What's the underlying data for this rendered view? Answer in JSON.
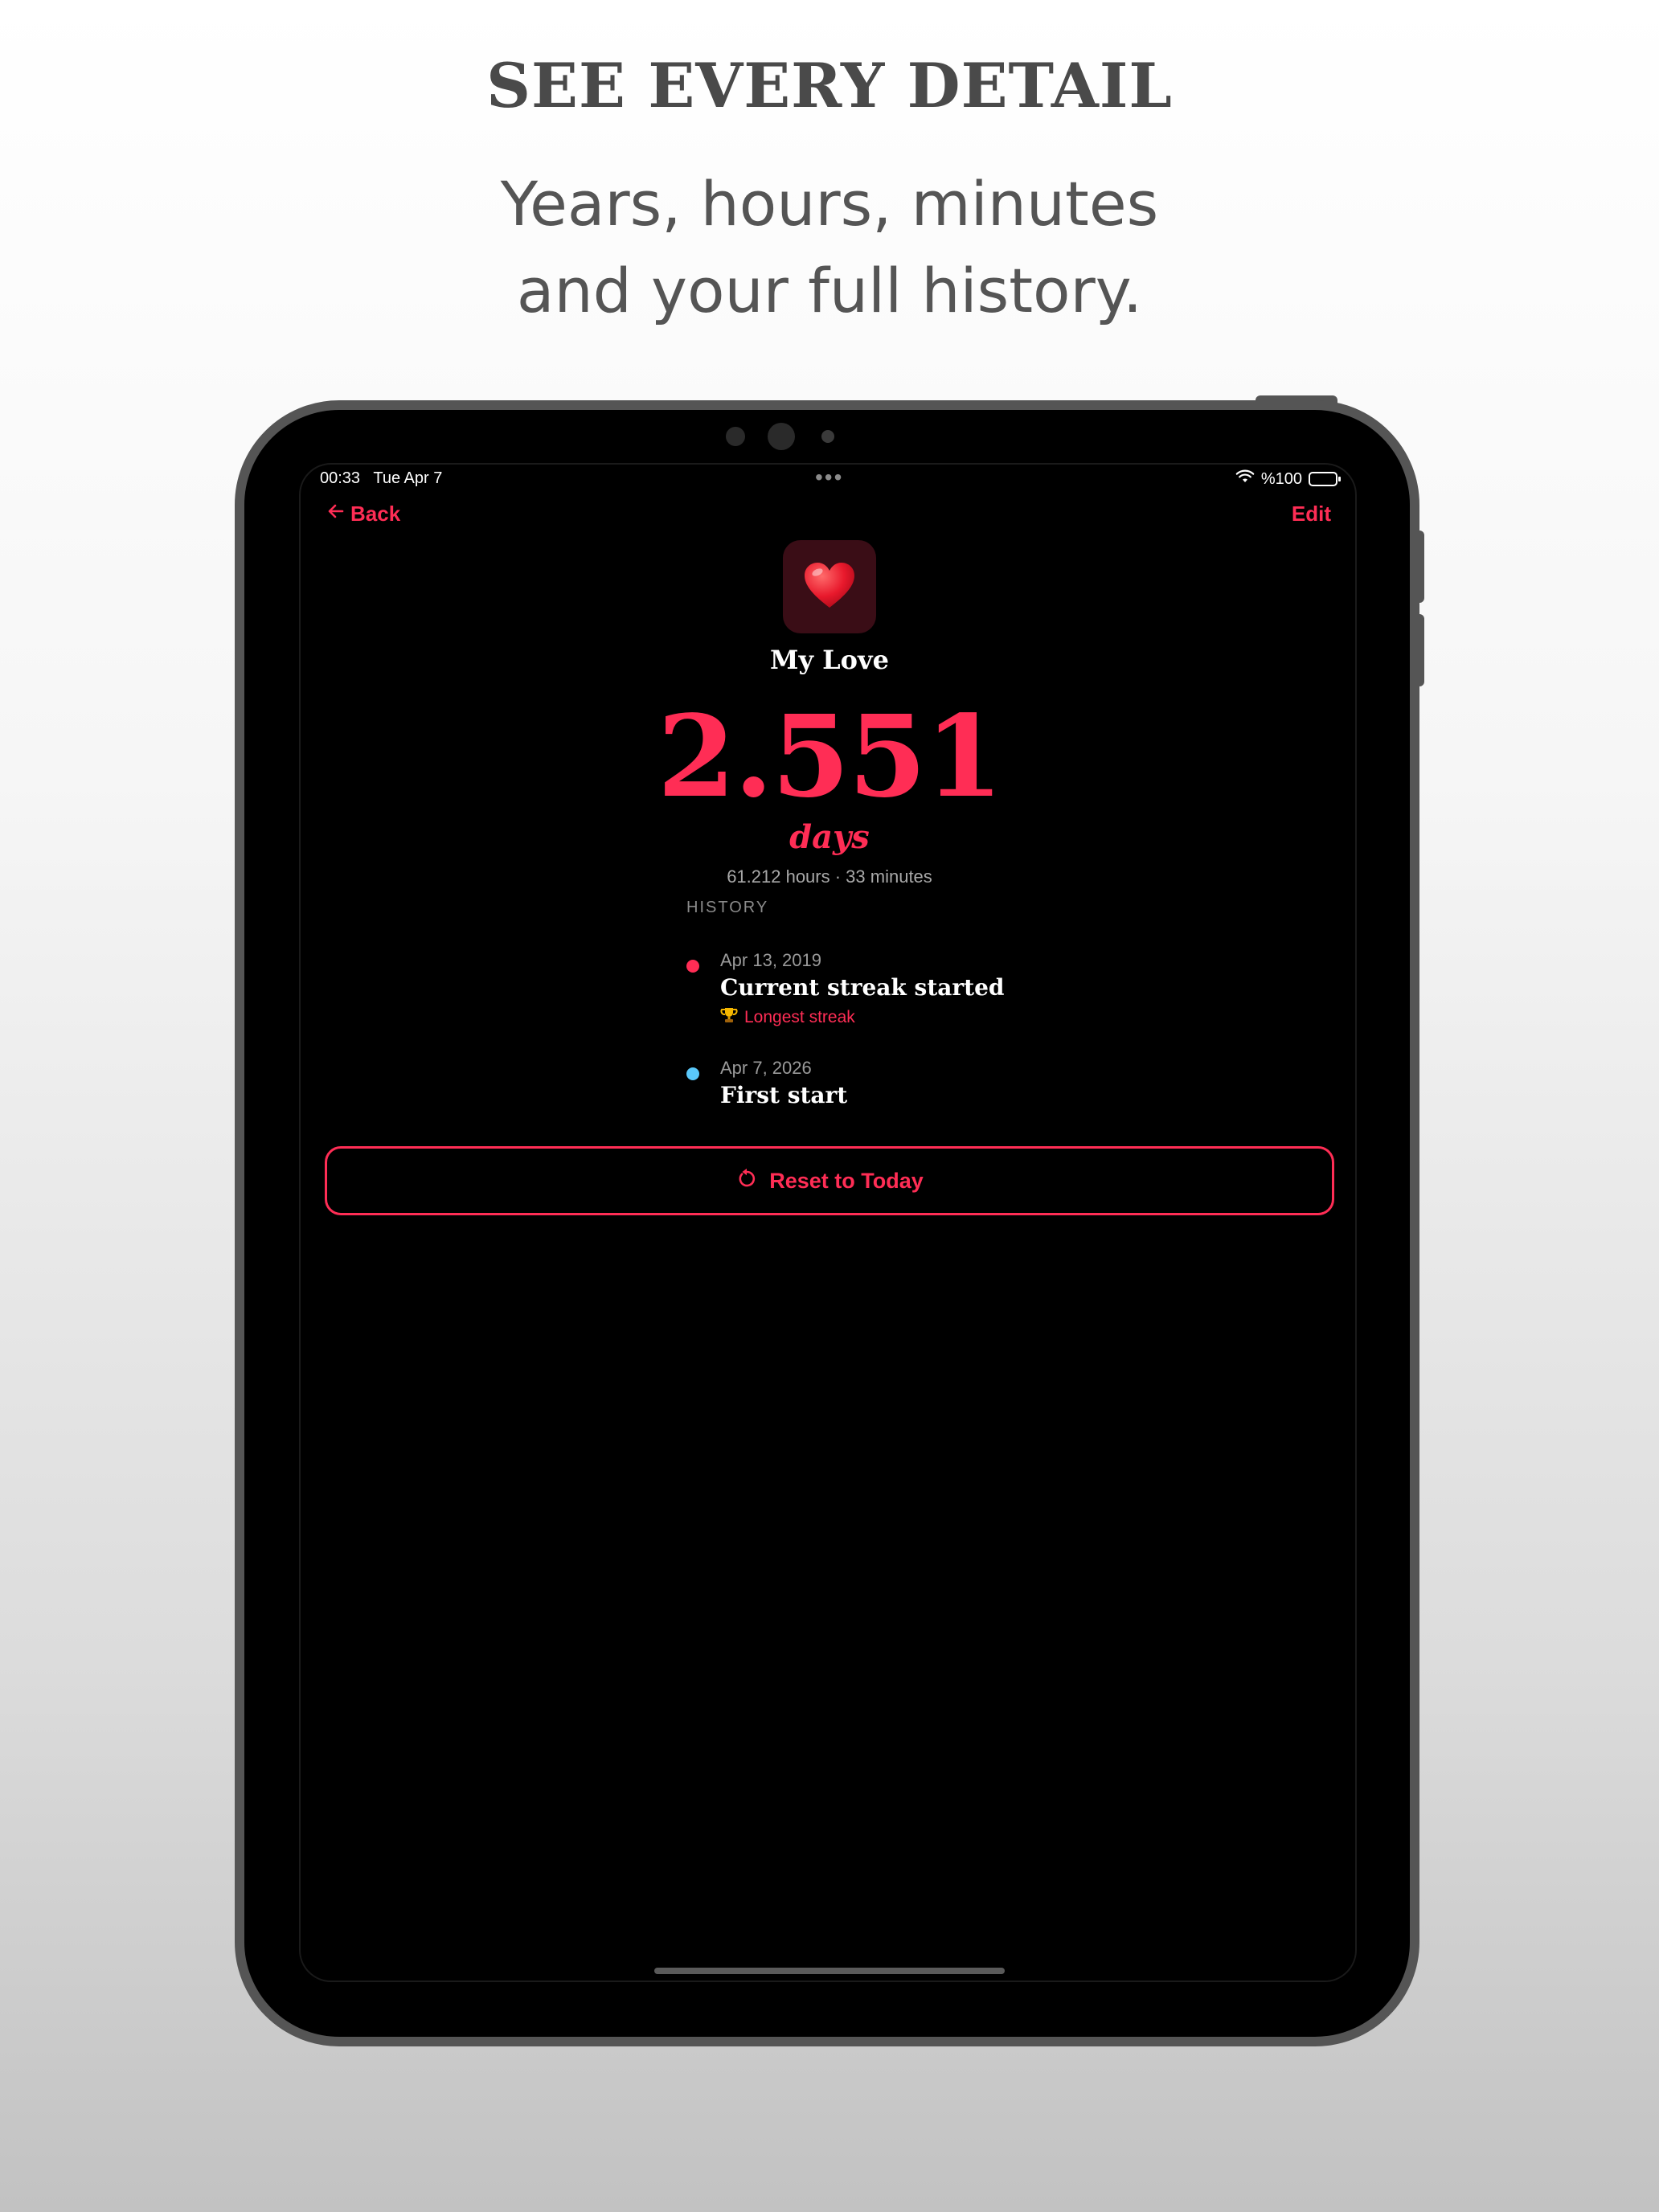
{
  "promo": {
    "headline": "SEE EVERY DETAIL",
    "subline_1": "Years, hours, minutes",
    "subline_2": "and your full history."
  },
  "status_bar": {
    "time": "00:33",
    "date": "Tue Apr 7",
    "battery": "%100"
  },
  "nav": {
    "back_label": "Back",
    "edit_label": "Edit"
  },
  "counter": {
    "icon": "heart-emoji",
    "title": "My Love",
    "value": "2.551",
    "unit": "days",
    "breakdown": "61.212 hours · 33 minutes"
  },
  "history": {
    "label": "HISTORY",
    "items": [
      {
        "date": "Apr 13, 2019",
        "title": "Current streak started",
        "badge": "Longest streak",
        "dot_color": "#ff2d55"
      },
      {
        "date": "Apr 7, 2026",
        "title": "First start",
        "dot_color": "#5ac8fa"
      }
    ]
  },
  "actions": {
    "reset_label": "Reset to Today"
  },
  "colors": {
    "accent": "#ff2d55",
    "secondary_dot": "#5ac8fa"
  }
}
